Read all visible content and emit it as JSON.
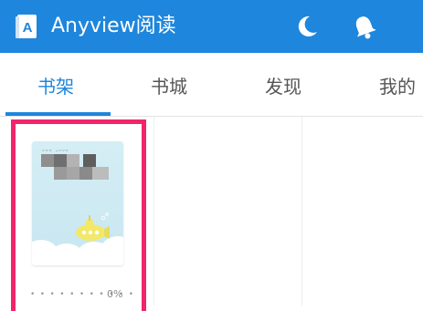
{
  "appbar": {
    "title": "Anyview阅读",
    "logo_letter": "A",
    "icons": [
      "book-logo-icon",
      "moon-icon",
      "bell-icon"
    ],
    "background_color": "#1e86dc"
  },
  "tabs": [
    {
      "label": "书架",
      "active": true
    },
    {
      "label": "书城",
      "active": false
    },
    {
      "label": "发现",
      "active": false
    },
    {
      "label": "我的",
      "active": false
    }
  ],
  "accent_color": "#1e86dc",
  "highlight_color": "#f0256a",
  "bookshelf": {
    "books": [
      {
        "cover_scribble": "ᵕᵕᵕ ·ᵕᵕᵕ",
        "progress_label": "0%",
        "progress": 0
      }
    ]
  }
}
